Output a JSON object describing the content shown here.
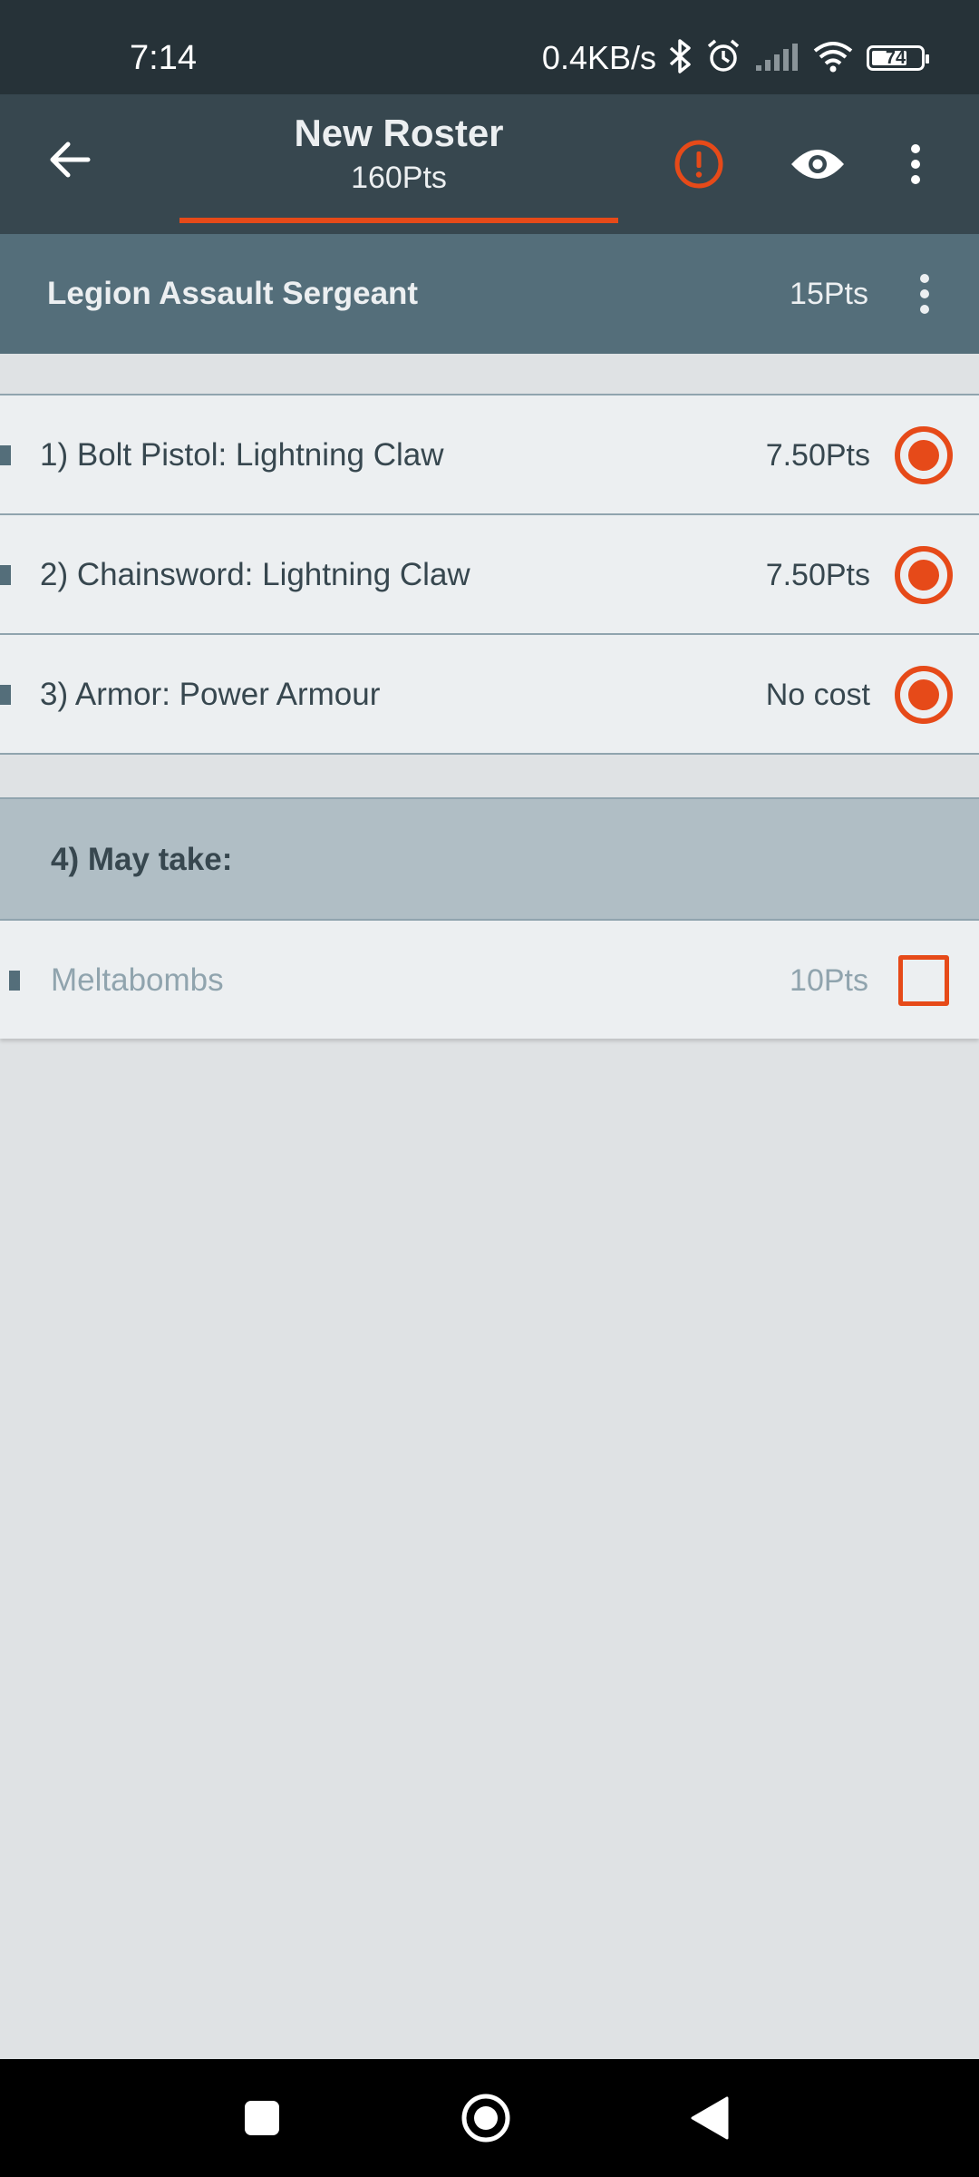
{
  "status_bar": {
    "time": "7:14",
    "network_speed": "0.4KB/s",
    "battery_level": "74",
    "battery_fraction": 0.74,
    "icons": [
      "bluetooth-icon",
      "alarm-icon",
      "cellular-signal-icon",
      "wifi-icon",
      "battery-icon"
    ]
  },
  "toolbar": {
    "title": "New Roster",
    "subtitle": "160Pts",
    "icons": [
      "back-arrow-icon",
      "warning-icon",
      "eye-icon",
      "more-vert-icon"
    ],
    "accent_color": "#e64a19"
  },
  "unit": {
    "name": "Legion Assault Sergeant",
    "points": "15Pts"
  },
  "options": [
    {
      "label": "1) Bolt Pistol: Lightning Claw",
      "cost": "7.50Pts",
      "selected": true
    },
    {
      "label": "2) Chainsword: Lightning Claw",
      "cost": "7.50Pts",
      "selected": true
    },
    {
      "label": "3) Armor: Power Armour",
      "cost": "No cost",
      "selected": true
    }
  ],
  "group": {
    "title": "4) May take:",
    "items": [
      {
        "label": "Meltabombs",
        "cost": "10Pts",
        "checked": false
      }
    ]
  },
  "nav_bar": {
    "icons": [
      "recents-icon",
      "home-icon",
      "back-icon"
    ]
  }
}
